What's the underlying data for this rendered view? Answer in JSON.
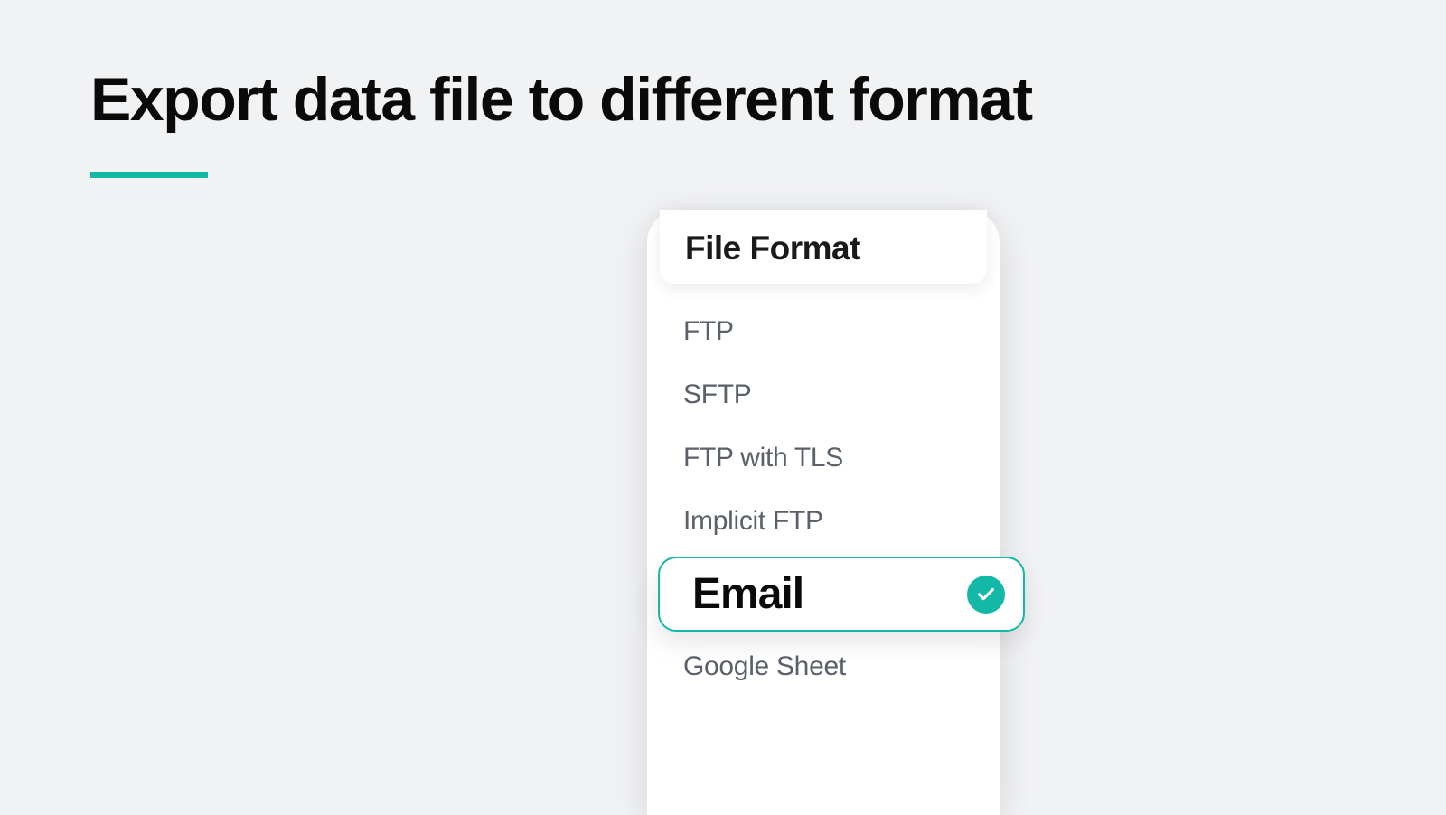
{
  "heading": {
    "title": "Export data file to different format"
  },
  "card": {
    "title": "File Format",
    "options": [
      {
        "label": "FTP",
        "selected": false
      },
      {
        "label": "SFTP",
        "selected": false
      },
      {
        "label": "FTP with TLS",
        "selected": false
      },
      {
        "label": "Implicit FTP",
        "selected": false
      },
      {
        "label": "Email",
        "selected": true
      },
      {
        "label": "Google Sheet",
        "selected": false
      }
    ]
  },
  "colors": {
    "accent": "#13b8a6",
    "background": "#f1f2f4",
    "text_primary": "#0a0a0a",
    "text_muted": "#5a6169"
  }
}
